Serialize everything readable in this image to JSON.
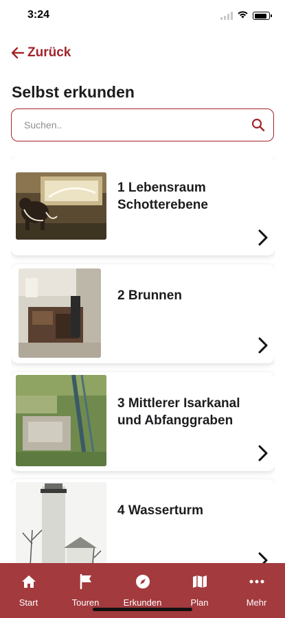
{
  "status_bar": {
    "time": "3:24",
    "battery_level": 0.85
  },
  "header": {
    "back_label": "Zurück",
    "title": "Selbst erkunden"
  },
  "search": {
    "placeholder": "Suchen..",
    "value": ""
  },
  "stations": [
    {
      "title": "1 Lebensraum Schotterebene",
      "thumbnail": "mammoth-exhibit"
    },
    {
      "title": "2 Brunnen",
      "thumbnail": "well-machinery-exhibit"
    },
    {
      "title": "3 Mittlerer Isarkanal und Abfanggraben",
      "thumbnail": "aerial-canal-view"
    },
    {
      "title": "4 Wasserturm",
      "thumbnail": "water-tower"
    }
  ],
  "tab_bar": {
    "items": [
      {
        "label": "Start",
        "icon": "home-icon"
      },
      {
        "label": "Touren",
        "icon": "flag-icon"
      },
      {
        "label": "Erkunden",
        "icon": "compass-icon"
      },
      {
        "label": "Plan",
        "icon": "map-icon"
      },
      {
        "label": "Mehr",
        "icon": "more-icon"
      }
    ]
  },
  "colors": {
    "accent": "#a1252b",
    "tab_bar_bg": "#a23a3e",
    "text": "#1c1c1e"
  }
}
